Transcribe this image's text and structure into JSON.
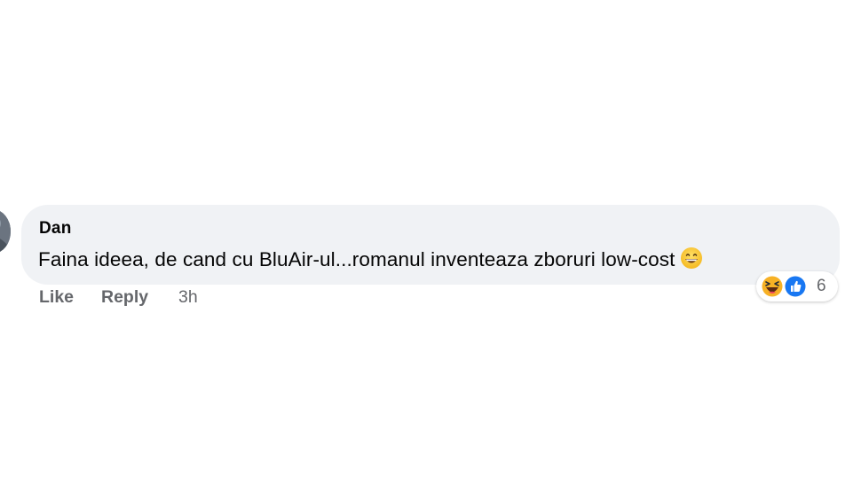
{
  "comment": {
    "author": "Dan",
    "text": "Faina ideea, de cand cu BluAir-ul...romanul inventeaza zboruri low-cost",
    "emoji_icon": "grinning-face-icon",
    "reactions": {
      "icons": [
        "haha-reaction-icon",
        "like-reaction-icon"
      ],
      "count": "6"
    },
    "actions": {
      "like_label": "Like",
      "reply_label": "Reply",
      "time": "3h"
    }
  },
  "colors": {
    "bubble": "#f0f2f5",
    "secondary_text": "#65676b",
    "primary_text": "#050505",
    "like_blue": "#1877f2",
    "haha_yellow": "#f7b125"
  }
}
